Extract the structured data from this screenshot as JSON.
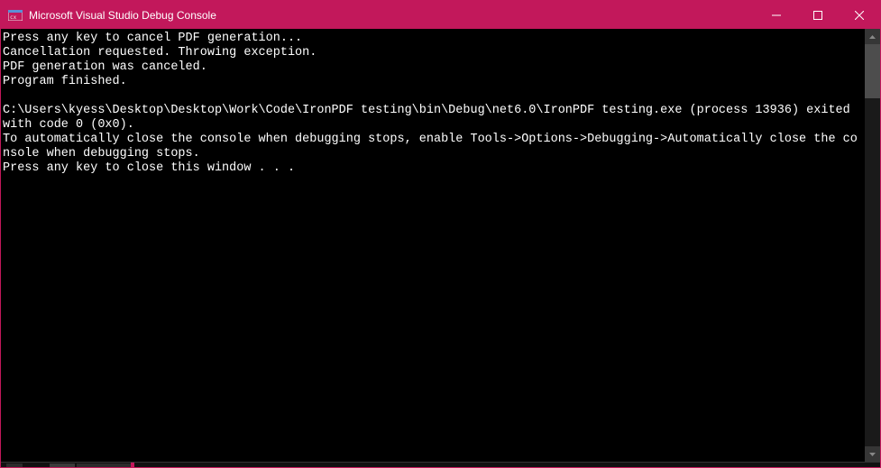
{
  "titlebar": {
    "title": "Microsoft Visual Studio Debug Console"
  },
  "console": {
    "line1": "Press any key to cancel PDF generation...",
    "line2": "Cancellation requested. Throwing exception.",
    "line3": "PDF generation was canceled.",
    "line4": "Program finished.",
    "blank": "",
    "exit_msg": "C:\\Users\\kyess\\Desktop\\Desktop\\Work\\Code\\IronPDF testing\\bin\\Debug\\net6.0\\IronPDF testing.exe (process 13936) exited with code 0 (0x0).",
    "auto_close_msg": "To automatically close the console when debugging stops, enable Tools->Options->Debugging->Automatically close the console when debugging stops.",
    "press_key": "Press any key to close this window . . ."
  },
  "colors": {
    "accent": "#c2185b",
    "bg": "#000000",
    "fg": "#ffffff"
  }
}
